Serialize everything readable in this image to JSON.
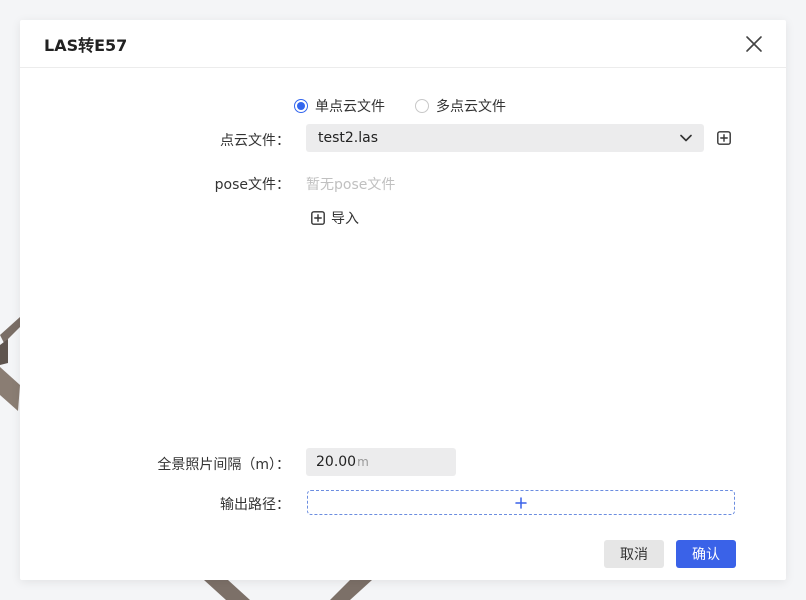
{
  "dialog": {
    "title": "LAS转E57"
  },
  "mode": {
    "options": [
      {
        "label": "单点云文件",
        "checked": true
      },
      {
        "label": "多点云文件",
        "checked": false
      }
    ]
  },
  "pointcloud": {
    "label": "点云文件：",
    "selected": "test2.las"
  },
  "pose": {
    "label": "pose文件：",
    "empty_text": "暂无pose文件",
    "import_label": "导入"
  },
  "interval": {
    "label": "全景照片间隔（m）：",
    "value": "20.00",
    "unit": "m"
  },
  "output": {
    "label": "输出路径："
  },
  "footer": {
    "cancel_label": "取消",
    "confirm_label": "确认"
  },
  "colors": {
    "accent": "#3a62e8",
    "dashed_border": "#6b8de0"
  }
}
